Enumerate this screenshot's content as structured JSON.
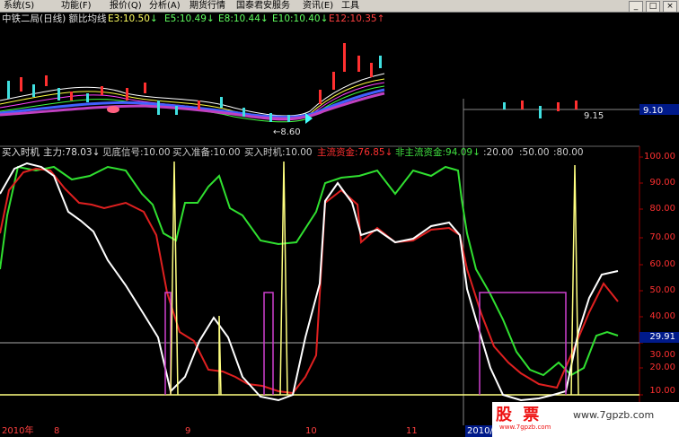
{
  "menu": {
    "items": [
      "系统(S)",
      "功能(F)",
      "报价(Q)",
      "分析(A)",
      "期货行情",
      "国泰君安服务",
      "资讯(E)",
      "工具"
    ],
    "window_buttons": [
      "_",
      "□",
      "×"
    ]
  },
  "main_chart": {
    "title": "中铁二局(日线) 额比均线",
    "ema_labels": [
      {
        "text": "E3:10.50",
        "arrow": "↓",
        "color": "#ffff60"
      },
      {
        "text": "E5:10.49",
        "arrow": "↓",
        "color": "#60ff60"
      },
      {
        "text": "E8:10.44",
        "arrow": "↓",
        "color": "#60ff60"
      },
      {
        "text": "E10:10.40",
        "arrow": "↓",
        "color": "#60ff60"
      },
      {
        "text": "E12:10.35",
        "arrow": "↑",
        "color": "#ff4040"
      }
    ],
    "low_marker": "←8.60",
    "low_marker2": "9.15",
    "right_price": "9.10"
  },
  "indicator": {
    "title": "买入时机",
    "labels": [
      {
        "text": "主力:78.03",
        "arrow": "↓",
        "color": "#e0e0e0"
      },
      {
        "text": "见底信号:10.00",
        "arrow": "",
        "color": "#ff3030"
      },
      {
        "text": "买入准备:10.00",
        "arrow": "",
        "color": "#d040d0"
      },
      {
        "text": "买入时机:10.00",
        "arrow": "",
        "color": "#e0e0e0"
      },
      {
        "text": "主流资金:76.85",
        "arrow": "↓",
        "color": "#ff3030"
      },
      {
        "text": "非主流资金:94.09",
        "arrow": "↓",
        "color": "#40e040"
      },
      {
        "text": ":20.00",
        "arrow": "",
        "color": "#d040d0"
      },
      {
        "text": ":50.00",
        "arrow": "",
        "color": "#40e040"
      },
      {
        "text": ":80.00",
        "arrow": "",
        "color": "#e0e0e0"
      }
    ],
    "y_ticks": [
      "100.00",
      "90.00",
      "80.00",
      "70.00",
      "60.00",
      "50.00",
      "40.00",
      "30.00",
      "20.00",
      "10.00"
    ],
    "current_value": "29.91"
  },
  "date_axis": [
    "2010年",
    "8",
    "9",
    "10",
    "11",
    "2010/1"
  ],
  "watermark": {
    "logo": "股 票",
    "sub": "www.7gpzb.com",
    "url": "www.7gpzb.com"
  }
}
